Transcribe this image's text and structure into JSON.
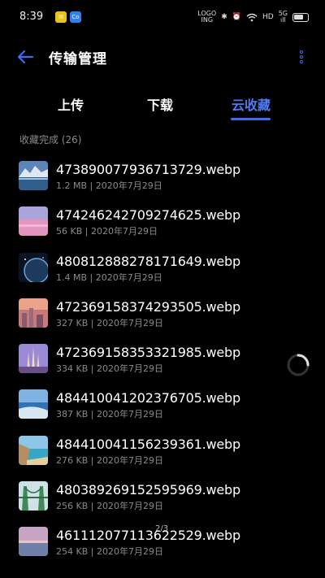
{
  "status_bar": {
    "time": "8:39",
    "badge_1": "✉",
    "badge_2": "Co",
    "network_badge": "LOGO\nING",
    "hd": "HD",
    "signal": "5G\nill"
  },
  "header": {
    "title": "传输管理",
    "back_icon": "back-arrow-icon",
    "more_icon": "more-icon",
    "accent_color": "#3b6cf6"
  },
  "tabs": [
    {
      "label": "上传",
      "active": false
    },
    {
      "label": "下载",
      "active": false
    },
    {
      "label": "云收藏",
      "active": true
    }
  ],
  "section": {
    "label": "收藏完成 (26)"
  },
  "files": [
    {
      "name": "473890077936713729.webp",
      "meta": "1.2 MB | 2020年7月29日",
      "thumb": "mountain-lake"
    },
    {
      "name": "474246242709274625.webp",
      "meta": "56 KB | 2020年7月29日",
      "thumb": "pink-sky"
    },
    {
      "name": "480812888278171649.webp",
      "meta": "1.4 MB | 2020年7月29日",
      "thumb": "planet"
    },
    {
      "name": "472369158374293505.webp",
      "meta": "327 KB | 2020年7月29日",
      "thumb": "city-sunset"
    },
    {
      "name": "472369158353321985.webp",
      "meta": "334 KB | 2020年7月29日",
      "thumb": "cathedral"
    },
    {
      "name": "484410041202376705.webp",
      "meta": "387 KB | 2020年7月29日",
      "thumb": "ocean-coast"
    },
    {
      "name": "484410041156239361.webp",
      "meta": "276 KB | 2020年7月29日",
      "thumb": "beach-cliff"
    },
    {
      "name": "480389269152595969.webp",
      "meta": "256 KB | 2020年7月29日",
      "thumb": "green-bridge"
    },
    {
      "name": "461112077113622529.webp",
      "meta": "254 KB | 2020年7月29日",
      "thumb": "sunset-sea"
    }
  ],
  "page_indicator": "2/3"
}
